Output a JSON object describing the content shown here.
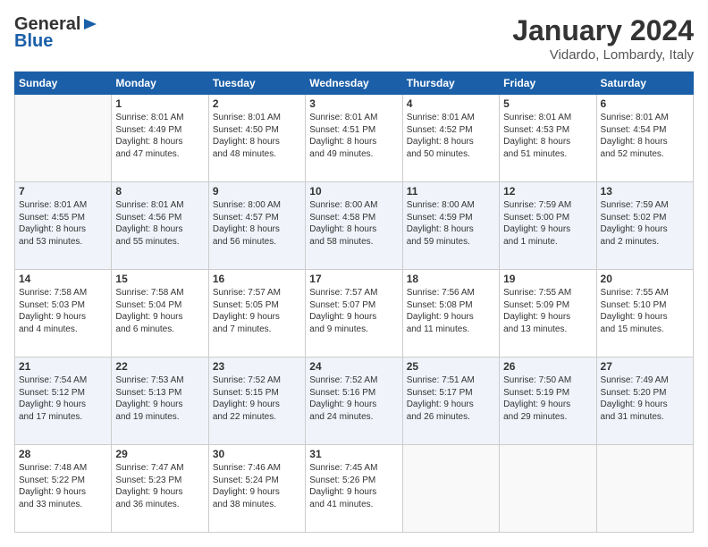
{
  "header": {
    "logo_general": "General",
    "logo_blue": "Blue",
    "month_title": "January 2024",
    "location": "Vidardo, Lombardy, Italy"
  },
  "days_of_week": [
    "Sunday",
    "Monday",
    "Tuesday",
    "Wednesday",
    "Thursday",
    "Friday",
    "Saturday"
  ],
  "weeks": [
    [
      {
        "day": "",
        "detail": ""
      },
      {
        "day": "1",
        "detail": "Sunrise: 8:01 AM\nSunset: 4:49 PM\nDaylight: 8 hours\nand 47 minutes."
      },
      {
        "day": "2",
        "detail": "Sunrise: 8:01 AM\nSunset: 4:50 PM\nDaylight: 8 hours\nand 48 minutes."
      },
      {
        "day": "3",
        "detail": "Sunrise: 8:01 AM\nSunset: 4:51 PM\nDaylight: 8 hours\nand 49 minutes."
      },
      {
        "day": "4",
        "detail": "Sunrise: 8:01 AM\nSunset: 4:52 PM\nDaylight: 8 hours\nand 50 minutes."
      },
      {
        "day": "5",
        "detail": "Sunrise: 8:01 AM\nSunset: 4:53 PM\nDaylight: 8 hours\nand 51 minutes."
      },
      {
        "day": "6",
        "detail": "Sunrise: 8:01 AM\nSunset: 4:54 PM\nDaylight: 8 hours\nand 52 minutes."
      }
    ],
    [
      {
        "day": "7",
        "detail": "Sunrise: 8:01 AM\nSunset: 4:55 PM\nDaylight: 8 hours\nand 53 minutes."
      },
      {
        "day": "8",
        "detail": "Sunrise: 8:01 AM\nSunset: 4:56 PM\nDaylight: 8 hours\nand 55 minutes."
      },
      {
        "day": "9",
        "detail": "Sunrise: 8:00 AM\nSunset: 4:57 PM\nDaylight: 8 hours\nand 56 minutes."
      },
      {
        "day": "10",
        "detail": "Sunrise: 8:00 AM\nSunset: 4:58 PM\nDaylight: 8 hours\nand 58 minutes."
      },
      {
        "day": "11",
        "detail": "Sunrise: 8:00 AM\nSunset: 4:59 PM\nDaylight: 8 hours\nand 59 minutes."
      },
      {
        "day": "12",
        "detail": "Sunrise: 7:59 AM\nSunset: 5:00 PM\nDaylight: 9 hours\nand 1 minute."
      },
      {
        "day": "13",
        "detail": "Sunrise: 7:59 AM\nSunset: 5:02 PM\nDaylight: 9 hours\nand 2 minutes."
      }
    ],
    [
      {
        "day": "14",
        "detail": "Sunrise: 7:58 AM\nSunset: 5:03 PM\nDaylight: 9 hours\nand 4 minutes."
      },
      {
        "day": "15",
        "detail": "Sunrise: 7:58 AM\nSunset: 5:04 PM\nDaylight: 9 hours\nand 6 minutes."
      },
      {
        "day": "16",
        "detail": "Sunrise: 7:57 AM\nSunset: 5:05 PM\nDaylight: 9 hours\nand 7 minutes."
      },
      {
        "day": "17",
        "detail": "Sunrise: 7:57 AM\nSunset: 5:07 PM\nDaylight: 9 hours\nand 9 minutes."
      },
      {
        "day": "18",
        "detail": "Sunrise: 7:56 AM\nSunset: 5:08 PM\nDaylight: 9 hours\nand 11 minutes."
      },
      {
        "day": "19",
        "detail": "Sunrise: 7:55 AM\nSunset: 5:09 PM\nDaylight: 9 hours\nand 13 minutes."
      },
      {
        "day": "20",
        "detail": "Sunrise: 7:55 AM\nSunset: 5:10 PM\nDaylight: 9 hours\nand 15 minutes."
      }
    ],
    [
      {
        "day": "21",
        "detail": "Sunrise: 7:54 AM\nSunset: 5:12 PM\nDaylight: 9 hours\nand 17 minutes."
      },
      {
        "day": "22",
        "detail": "Sunrise: 7:53 AM\nSunset: 5:13 PM\nDaylight: 9 hours\nand 19 minutes."
      },
      {
        "day": "23",
        "detail": "Sunrise: 7:52 AM\nSunset: 5:15 PM\nDaylight: 9 hours\nand 22 minutes."
      },
      {
        "day": "24",
        "detail": "Sunrise: 7:52 AM\nSunset: 5:16 PM\nDaylight: 9 hours\nand 24 minutes."
      },
      {
        "day": "25",
        "detail": "Sunrise: 7:51 AM\nSunset: 5:17 PM\nDaylight: 9 hours\nand 26 minutes."
      },
      {
        "day": "26",
        "detail": "Sunrise: 7:50 AM\nSunset: 5:19 PM\nDaylight: 9 hours\nand 29 minutes."
      },
      {
        "day": "27",
        "detail": "Sunrise: 7:49 AM\nSunset: 5:20 PM\nDaylight: 9 hours\nand 31 minutes."
      }
    ],
    [
      {
        "day": "28",
        "detail": "Sunrise: 7:48 AM\nSunset: 5:22 PM\nDaylight: 9 hours\nand 33 minutes."
      },
      {
        "day": "29",
        "detail": "Sunrise: 7:47 AM\nSunset: 5:23 PM\nDaylight: 9 hours\nand 36 minutes."
      },
      {
        "day": "30",
        "detail": "Sunrise: 7:46 AM\nSunset: 5:24 PM\nDaylight: 9 hours\nand 38 minutes."
      },
      {
        "day": "31",
        "detail": "Sunrise: 7:45 AM\nSunset: 5:26 PM\nDaylight: 9 hours\nand 41 minutes."
      },
      {
        "day": "",
        "detail": ""
      },
      {
        "day": "",
        "detail": ""
      },
      {
        "day": "",
        "detail": ""
      }
    ]
  ]
}
